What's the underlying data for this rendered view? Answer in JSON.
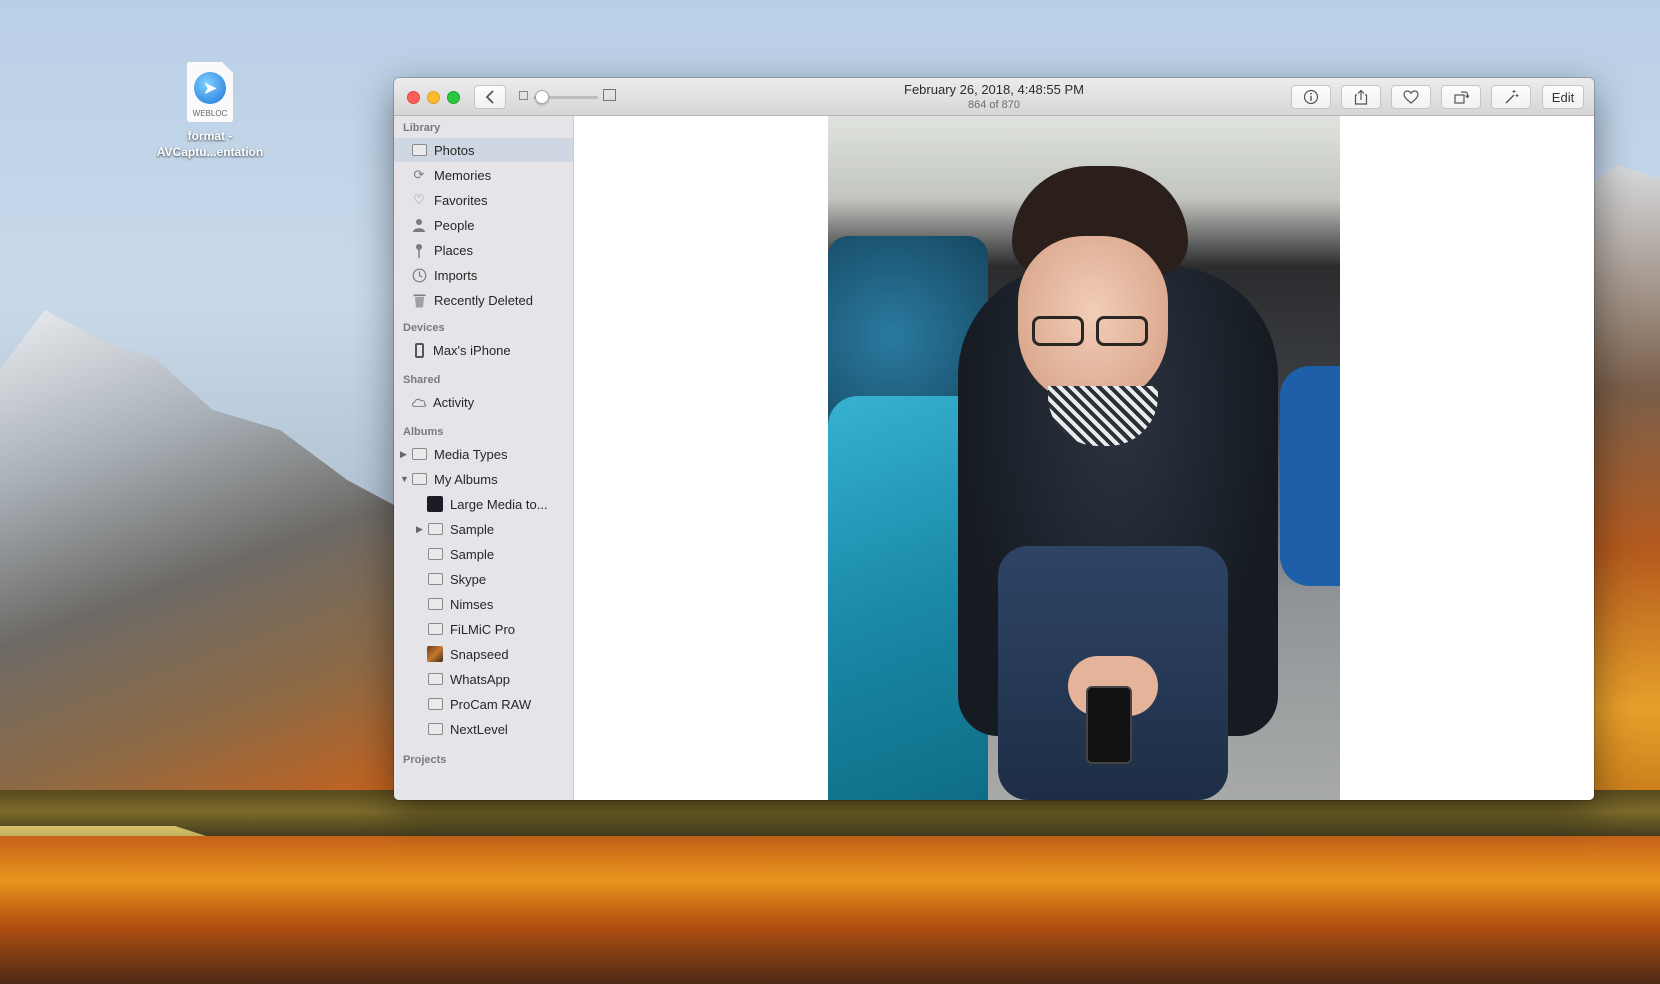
{
  "desktop": {
    "file": {
      "badge": "WEBLOC",
      "name_line1": "format -",
      "name_line2": "AVCaptu...entation"
    }
  },
  "window": {
    "title": "February 26, 2018, 4:48:55 PM",
    "subtitle": "864 of 870",
    "zoom_level": 0.1,
    "toolbar": {
      "edit_label": "Edit"
    }
  },
  "sidebar": {
    "library": {
      "header": "Library",
      "items": [
        {
          "label": "Photos",
          "icon": "photos-icon",
          "selected": true
        },
        {
          "label": "Memories",
          "icon": "memories-icon"
        },
        {
          "label": "Favorites",
          "icon": "heart-icon"
        },
        {
          "label": "People",
          "icon": "person-icon"
        },
        {
          "label": "Places",
          "icon": "pin-icon"
        },
        {
          "label": "Imports",
          "icon": "clock-icon"
        },
        {
          "label": "Recently Deleted",
          "icon": "trash-icon"
        }
      ]
    },
    "devices": {
      "header": "Devices",
      "items": [
        {
          "label": "Max's iPhone",
          "icon": "iphone-icon"
        }
      ]
    },
    "shared": {
      "header": "Shared",
      "items": [
        {
          "label": "Activity",
          "icon": "cloud-icon"
        }
      ]
    },
    "albums": {
      "header": "Albums",
      "items": [
        {
          "label": "Media Types",
          "icon": "album-icon"
        },
        {
          "label": "My Albums",
          "icon": "album-icon"
        },
        {
          "label": "Large Media to...",
          "icon": "album-thumbnail"
        },
        {
          "label": "Sample",
          "icon": "folder-icon"
        },
        {
          "label": "Sample",
          "icon": "album-icon"
        },
        {
          "label": "Skype",
          "icon": "album-icon"
        },
        {
          "label": "Nimses",
          "icon": "album-icon"
        },
        {
          "label": "FiLMiC Pro",
          "icon": "album-icon"
        },
        {
          "label": "Snapseed",
          "icon": "album-thumbnail"
        },
        {
          "label": "WhatsApp",
          "icon": "album-icon"
        },
        {
          "label": "ProCam RAW",
          "icon": "album-icon"
        },
        {
          "label": "NextLevel",
          "icon": "album-icon"
        }
      ]
    },
    "projects": {
      "header": "Projects"
    }
  },
  "colors": {
    "selection": "#cfd7e3",
    "sidebar_bg": "#e6e4e8",
    "close": "#fc5f57",
    "minimize": "#fdbc2e",
    "zoom": "#28c840"
  }
}
